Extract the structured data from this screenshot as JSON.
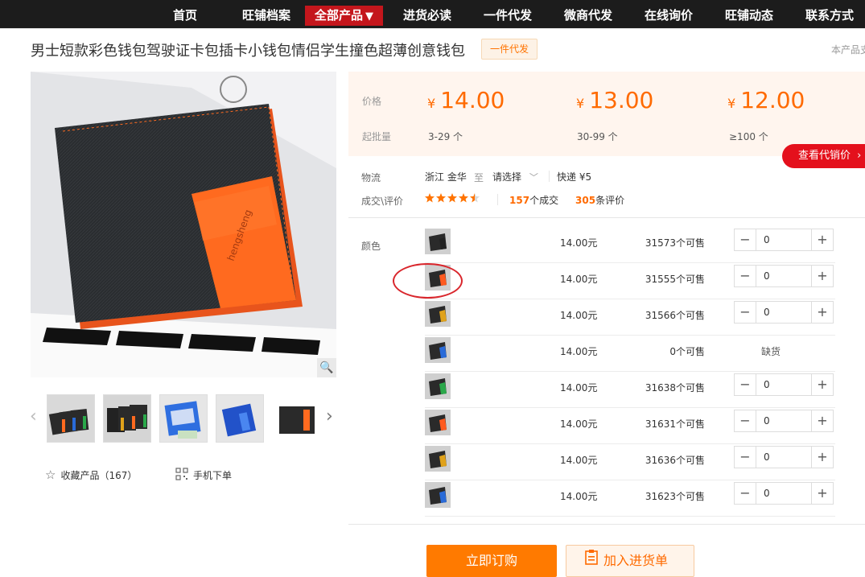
{
  "nav": {
    "items": [
      {
        "label": "首页"
      },
      {
        "label": "旺铺档案"
      },
      {
        "label": "全部产品",
        "caret": "▼"
      },
      {
        "label": "进货必读"
      },
      {
        "label": "一件代发"
      },
      {
        "label": "微商代发"
      },
      {
        "label": "在线询价"
      },
      {
        "label": "旺铺动态"
      },
      {
        "label": "联系方式"
      }
    ],
    "active_color": "#c4161c"
  },
  "product": {
    "title": "男士短款彩色钱包驾驶证卡包插卡小钱包情侣学生撞色超薄创意钱包",
    "tag": "一件代发",
    "side_note": "本产品支",
    "main_image_brand": "hengsheng"
  },
  "pricing": {
    "price_label": "价格",
    "moq_label": "起批量",
    "currency_symbol": "¥",
    "tiers": [
      {
        "price": "14.00",
        "range": "3-29 个"
      },
      {
        "price": "13.00",
        "range": "30-99 个"
      },
      {
        "price": "12.00",
        "range": "≥100 个"
      }
    ],
    "agent_price_button": "查看代销价",
    "accent_color": "#ff6a00"
  },
  "logistics": {
    "label": "物流",
    "origin": "浙江 金华",
    "to": "至",
    "select": "请选择",
    "shipping": "快递 ¥5"
  },
  "reviews": {
    "label": "成交\\评价",
    "rating_stars": 4.5,
    "deals_count": "157",
    "deals_suffix": "个成交",
    "review_count": "305",
    "review_suffix": "条评价"
  },
  "sku": {
    "label": "颜色",
    "rows": [
      {
        "price": "14.00元",
        "stock": "31573个可售",
        "qty": "0",
        "accent": "#222222"
      },
      {
        "price": "14.00元",
        "stock": "31555个可售",
        "qty": "0",
        "accent": "#ff5a1f"
      },
      {
        "price": "14.00元",
        "stock": "31566个可售",
        "qty": "0",
        "accent": "#e0a21a"
      },
      {
        "price": "14.00元",
        "stock": "0个可售",
        "qty": "",
        "sold_out": "缺货",
        "accent": "#2a6bd8"
      },
      {
        "price": "14.00元",
        "stock": "31638个可售",
        "qty": "0",
        "accent": "#2aa84a"
      },
      {
        "price": "14.00元",
        "stock": "31631个可售",
        "qty": "0",
        "accent": "#ff5a1f"
      },
      {
        "price": "14.00元",
        "stock": "31636个可售",
        "qty": "0",
        "accent": "#e0a21a"
      },
      {
        "price": "14.00元",
        "stock": "31623个可售",
        "qty": "0",
        "accent": "#2a6bd8"
      }
    ]
  },
  "actions": {
    "favorite": "收藏产品（167）",
    "mobile_order": "手机下单",
    "buy_now": "立即订购",
    "add_to_cart": "加入进货单"
  }
}
